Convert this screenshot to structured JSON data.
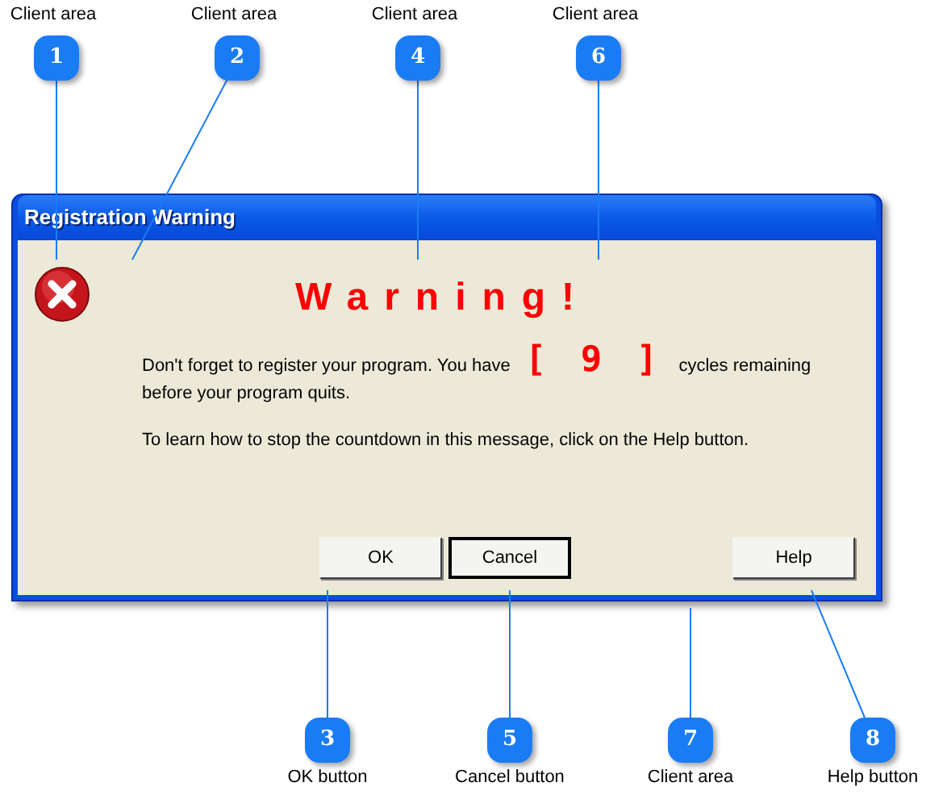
{
  "callouts_top": [
    {
      "number": "1",
      "label": "Client area"
    },
    {
      "number": "2",
      "label": "Client area"
    },
    {
      "number": "4",
      "label": "Client area"
    },
    {
      "number": "6",
      "label": "Client area"
    }
  ],
  "window": {
    "title": "Registration Warning"
  },
  "dialog": {
    "heading": "Warning!",
    "message_before": "Don't forget to register your program.  You have",
    "count": "[ 9 ]",
    "message_after": "cycles remaining",
    "message_end": "before your program quits.",
    "hint": "To learn how to stop the countdown in this message, click on the Help button."
  },
  "buttons": [
    {
      "label": "OK",
      "default": false
    },
    {
      "label": "Cancel",
      "default": true
    },
    {
      "label": "Help",
      "default": false
    }
  ],
  "callouts_bottom": [
    {
      "number": "3",
      "label": "OK button"
    },
    {
      "number": "5",
      "label": "Cancel button"
    },
    {
      "number": "7",
      "label": "Client area"
    },
    {
      "number": "8",
      "label": "Help button"
    }
  ]
}
